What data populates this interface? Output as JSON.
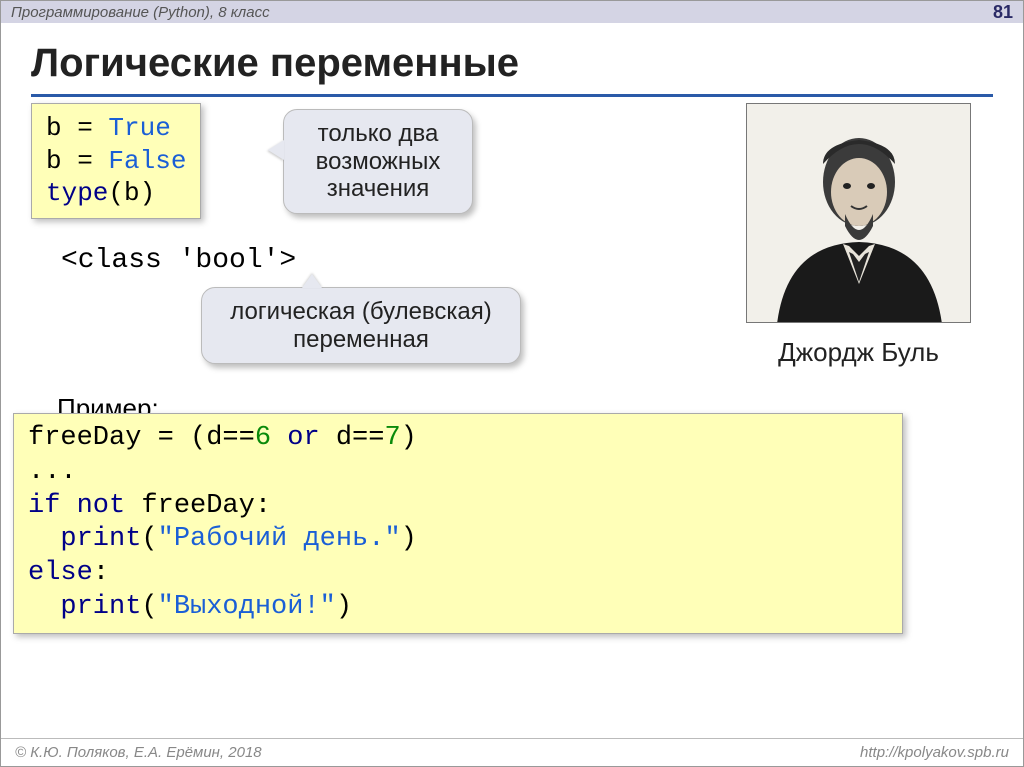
{
  "header": {
    "course": "Программирование (Python), 8 класс",
    "page": "81"
  },
  "title": "Логические переменные",
  "code1": {
    "l1a": "b = ",
    "l1b": "True",
    "l2a": "b = ",
    "l2b": "False",
    "l3a": "type",
    "l3b": "(b)"
  },
  "callout1": {
    "l1": "только два",
    "l2": "возможных",
    "l3": "значения"
  },
  "classline": "<class 'bool'>",
  "callout2": {
    "l1": "логическая (булевская)",
    "l2": "переменная"
  },
  "portrait_caption": "Джордж Буль",
  "example_label": "Пример:",
  "code2": {
    "l1a": "freeDay = (d==",
    "l1b": "6",
    "l1c": " or",
    "l1d": " d==",
    "l1e": "7",
    "l1f": ")",
    "l2": "...",
    "l3a": "if not",
    "l3b": " freeDay:",
    "l4a": "  print",
    "l4b": "(",
    "l4c": "\"Рабочий день.\"",
    "l4d": ")",
    "l5a": "else",
    "l5b": ":",
    "l6a": "  print",
    "l6b": "(",
    "l6c": "\"Выходной!\"",
    "l6d": ")"
  },
  "footer": {
    "left": "© К.Ю. Поляков, Е.А. Ерёмин, 2018",
    "right": "http://kpolyakov.spb.ru"
  }
}
